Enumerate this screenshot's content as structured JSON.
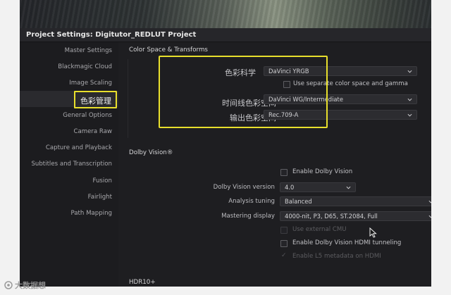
{
  "window": {
    "title": "Project Settings:  Digitutor_REDLUT  Project"
  },
  "sidebar": {
    "items": [
      {
        "label": "Master Settings"
      },
      {
        "label": "Blackmagic Cloud"
      },
      {
        "label": "Image Scaling"
      },
      {
        "label": "色彩管理"
      },
      {
        "label": "General Options"
      },
      {
        "label": "Camera Raw"
      },
      {
        "label": "Capture and Playback"
      },
      {
        "label": "Subtitles and Transcription"
      },
      {
        "label": "Fusion"
      },
      {
        "label": "Fairlight"
      },
      {
        "label": "Path Mapping"
      }
    ],
    "active_index": 3
  },
  "color_space": {
    "section_title": "Color Space & Transforms",
    "science_label": "色彩科学",
    "science_value": "DaVinci YRGB",
    "separate_label": "Use separate color space and gamma",
    "timeline_label": "时间线色彩空间",
    "timeline_value": "DaVinci WG/Intermediate",
    "output_label": "输出色彩空间",
    "output_value": "Rec.709-A"
  },
  "dolby": {
    "section_title": "Dolby Vision®",
    "enable_label": "Enable Dolby Vision",
    "version_label": "Dolby Vision version",
    "version_value": "4.0",
    "tuning_label": "Analysis tuning",
    "tuning_value": "Balanced",
    "mastering_label": "Mastering display",
    "mastering_value": "4000-nit, P3, D65, ST.2084, Full",
    "external_cmu_label": "Use external CMU",
    "hdmi_label": "Enable Dolby Vision HDMI tunneling",
    "l5_label": "Enable L5 metadata on HDMI"
  },
  "hdr10": {
    "section_title": "HDR10+"
  },
  "watermark": {
    "text": "大数据想"
  },
  "colors": {
    "highlight": "#e8df2c",
    "background": "#1e1e21"
  }
}
